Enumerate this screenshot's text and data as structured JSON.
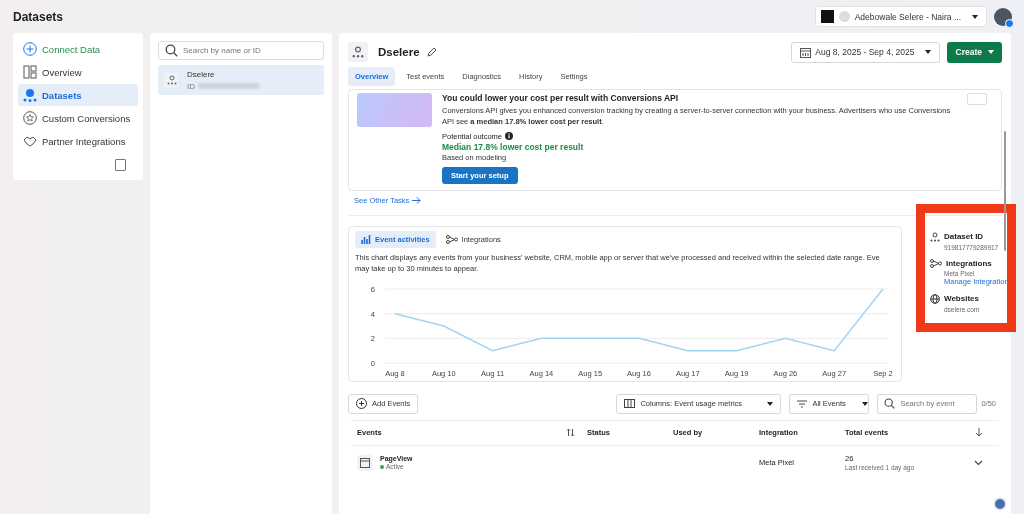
{
  "page_title": "Datasets",
  "account": {
    "name": "Adebowale Selere - Naira ..."
  },
  "nav": {
    "connect": "Connect Data",
    "items": [
      {
        "label": "Overview",
        "selected": false
      },
      {
        "label": "Datasets",
        "selected": true
      },
      {
        "label": "Custom Conversions",
        "selected": false
      },
      {
        "label": "Partner Integrations",
        "selected": false
      }
    ]
  },
  "dataset_list": {
    "search": {
      "placeholder": "Search by name or ID"
    },
    "items": [
      {
        "name": "Dselere",
        "id_label": "ID",
        "selected": true
      }
    ]
  },
  "dataset": {
    "name": "Dselere",
    "date_range": "Aug 8, 2025 - Sep 4, 2025",
    "create_button": "Create",
    "tabs": [
      {
        "label": "Overview",
        "selected": true
      },
      {
        "label": "Test events",
        "selected": false
      },
      {
        "label": "Diagnostics",
        "selected": false
      },
      {
        "label": "History",
        "selected": false
      },
      {
        "label": "Settings",
        "selected": false
      }
    ]
  },
  "promo": {
    "title": "You could lower your cost per result with Conversions API",
    "description": "Conversions API gives you enhanced conversion tracking by creating a server-to-server connection with your business. Advertisers who use Conversions API see **a median 17.8% lower cost per result**.",
    "outcome_label": "Potential outcome",
    "outcome_value": "Median 17.8% lower cost per result",
    "outcome_note": "Based on modeling",
    "button": "Start your setup"
  },
  "see_other_tasks": "See Other Tasks",
  "activity": {
    "tabs": [
      {
        "label": "Event activities",
        "selected": true
      },
      {
        "label": "Integrations",
        "selected": false
      }
    ],
    "description": "This chart displays any events from your business' website, CRM, mobile app or server that we've processed and received within the selected date range. Eve may take up to 30 minutes to appear.",
    "chart_data": {
      "type": "line",
      "categories": [
        "Aug 8",
        "Aug 10",
        "Aug 11",
        "Aug 14",
        "Aug 15",
        "Aug 16",
        "Aug 17",
        "Aug 19",
        "Aug 26",
        "Aug 27",
        "Sep 2"
      ],
      "series": [
        {
          "color": "#9fd4f5",
          "values": [
            4,
            3,
            1,
            2,
            2,
            2,
            1,
            1,
            2,
            1,
            6
          ]
        }
      ],
      "ylim": [
        0,
        6
      ],
      "yticks": [
        0,
        2,
        4,
        6
      ]
    }
  },
  "info": [
    {
      "kind": "id",
      "title": "Dataset ID",
      "value": "919817779289917"
    },
    {
      "kind": "integrations",
      "title": "Integrations",
      "value": "Meta Pixel",
      "link": "Manage Integration"
    },
    {
      "kind": "websites",
      "title": "Websites",
      "value": "dselere.com"
    }
  ],
  "toolbar": {
    "add_events": "Add Events",
    "columns": "Columns: Event usage metrics",
    "filter": "All Events",
    "search": {
      "placeholder": "Search by event"
    },
    "count": "0/50"
  },
  "table": {
    "columns": [
      "Events",
      "Status",
      "Used by",
      "Integration",
      "Total events"
    ],
    "rows": [
      {
        "event": "PageView",
        "status": "Active",
        "color": "#31a24c",
        "integration": "Meta Pixel",
        "total": "26",
        "last_received": "Last received 1 day ago"
      }
    ]
  }
}
